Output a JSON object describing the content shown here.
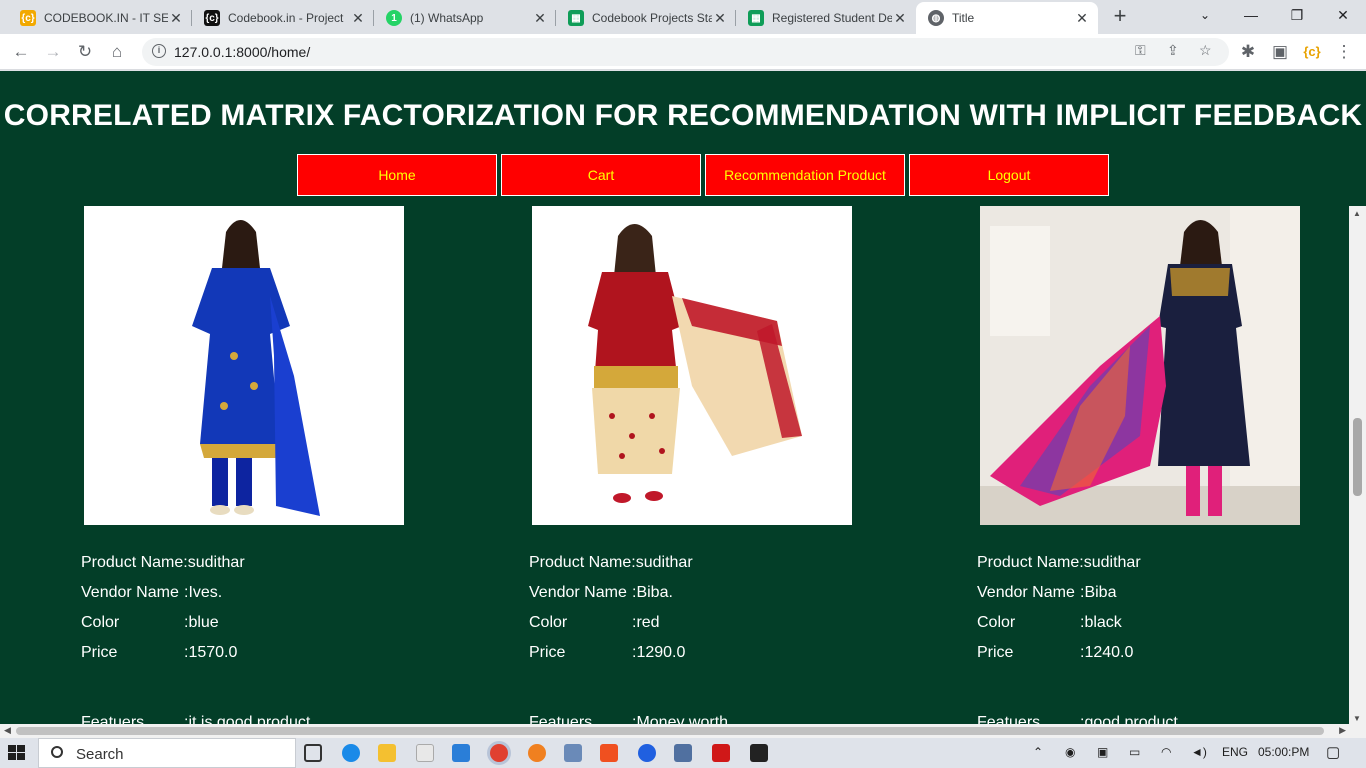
{
  "browser": {
    "tabs": [
      {
        "title": "CODEBOOK.IN - IT SER",
        "icon": "codebook-icon",
        "color": "#f2a900"
      },
      {
        "title": "Codebook.in - Project",
        "icon": "codebook-icon",
        "color": "#111111"
      },
      {
        "title": "(1) WhatsApp",
        "icon": "whatsapp-icon",
        "color": "#25d366"
      },
      {
        "title": "Codebook Projects Sta",
        "icon": "sheets-icon",
        "color": "#0f9d58"
      },
      {
        "title": "Registered Student De",
        "icon": "sheets-icon",
        "color": "#0f9d58"
      },
      {
        "title": "Title",
        "icon": "globe-icon",
        "color": "#5f6368"
      }
    ],
    "url": "127.0.0.1:8000/home/"
  },
  "page": {
    "title": "CORRELATED MATRIX FACTORIZATION FOR RECOMMENDATION WITH IMPLICIT FEEDBACK",
    "nav": [
      "Home",
      "Cart",
      "Recommendation Product",
      "Logout"
    ],
    "labels": {
      "product_name": "Product Name:",
      "vendor_name": "Vendor Name",
      "color": "Color",
      "price": "Price",
      "features": "Featuers"
    },
    "products": [
      {
        "name": "sudithar",
        "vendor": ":Ives.",
        "color": ":blue",
        "price": ":1570.0",
        "features": ":it is good product"
      },
      {
        "name": "sudithar",
        "vendor": ":Biba.",
        "color": ":red",
        "price": ":1290.0",
        "features": ":Money worth"
      },
      {
        "name": "sudithar",
        "vendor": ":Biba",
        "color": ":black",
        "price": ":1240.0",
        "features": ":good product"
      }
    ],
    "colors": {
      "background": "#033e28",
      "nav_bg": "#ff0000",
      "nav_text": "#ffff00"
    }
  },
  "taskbar": {
    "search_placeholder": "Search",
    "language": "ENG",
    "time": "05:00:PM"
  }
}
